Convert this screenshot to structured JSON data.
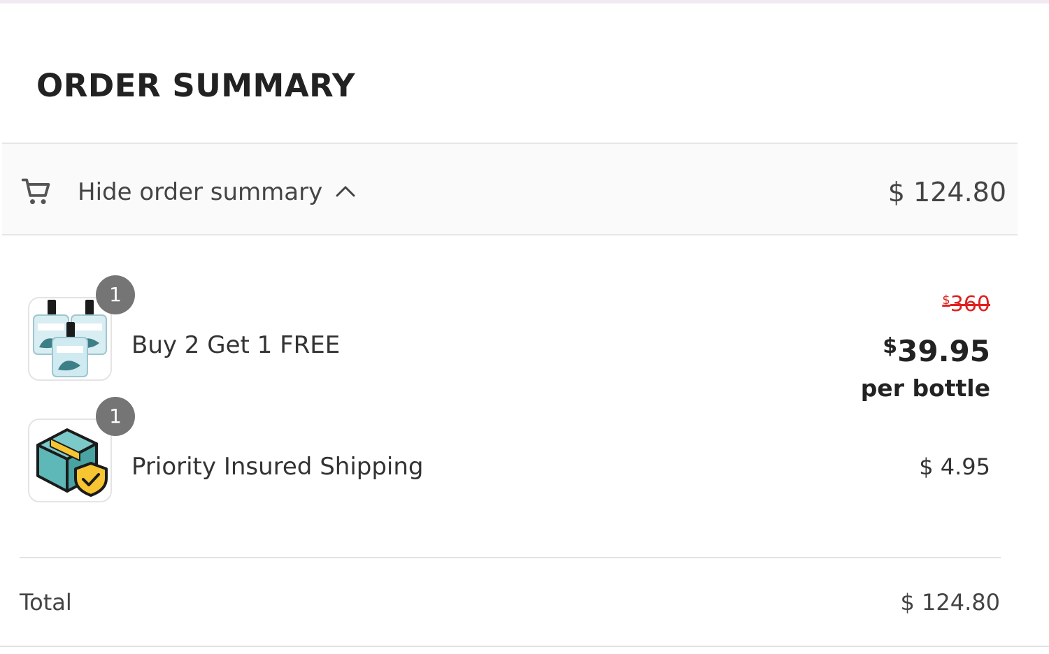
{
  "summary": {
    "title": "ORDER SUMMARY",
    "toggle_label": "Hide order summary",
    "toggle_total": "$ 124.80"
  },
  "items": [
    {
      "name": "Buy 2 Get 1 FREE",
      "quantity": "1",
      "thumbnail_icon": "perfume-bottles-icon",
      "old_price_currency": "$",
      "old_price": "360",
      "price_currency": "$",
      "price": "39.95",
      "price_unit": "per bottle"
    },
    {
      "name": "Priority Insured Shipping",
      "quantity": "1",
      "thumbnail_icon": "insured-package-icon",
      "price": "$ 4.95"
    }
  ],
  "totals": {
    "label": "Total",
    "value": "$ 124.80"
  },
  "colors": {
    "strike_price": "#e02020",
    "badge": "#757575",
    "package_teal": "#5fb8b8",
    "shield_yellow": "#f7c531"
  }
}
